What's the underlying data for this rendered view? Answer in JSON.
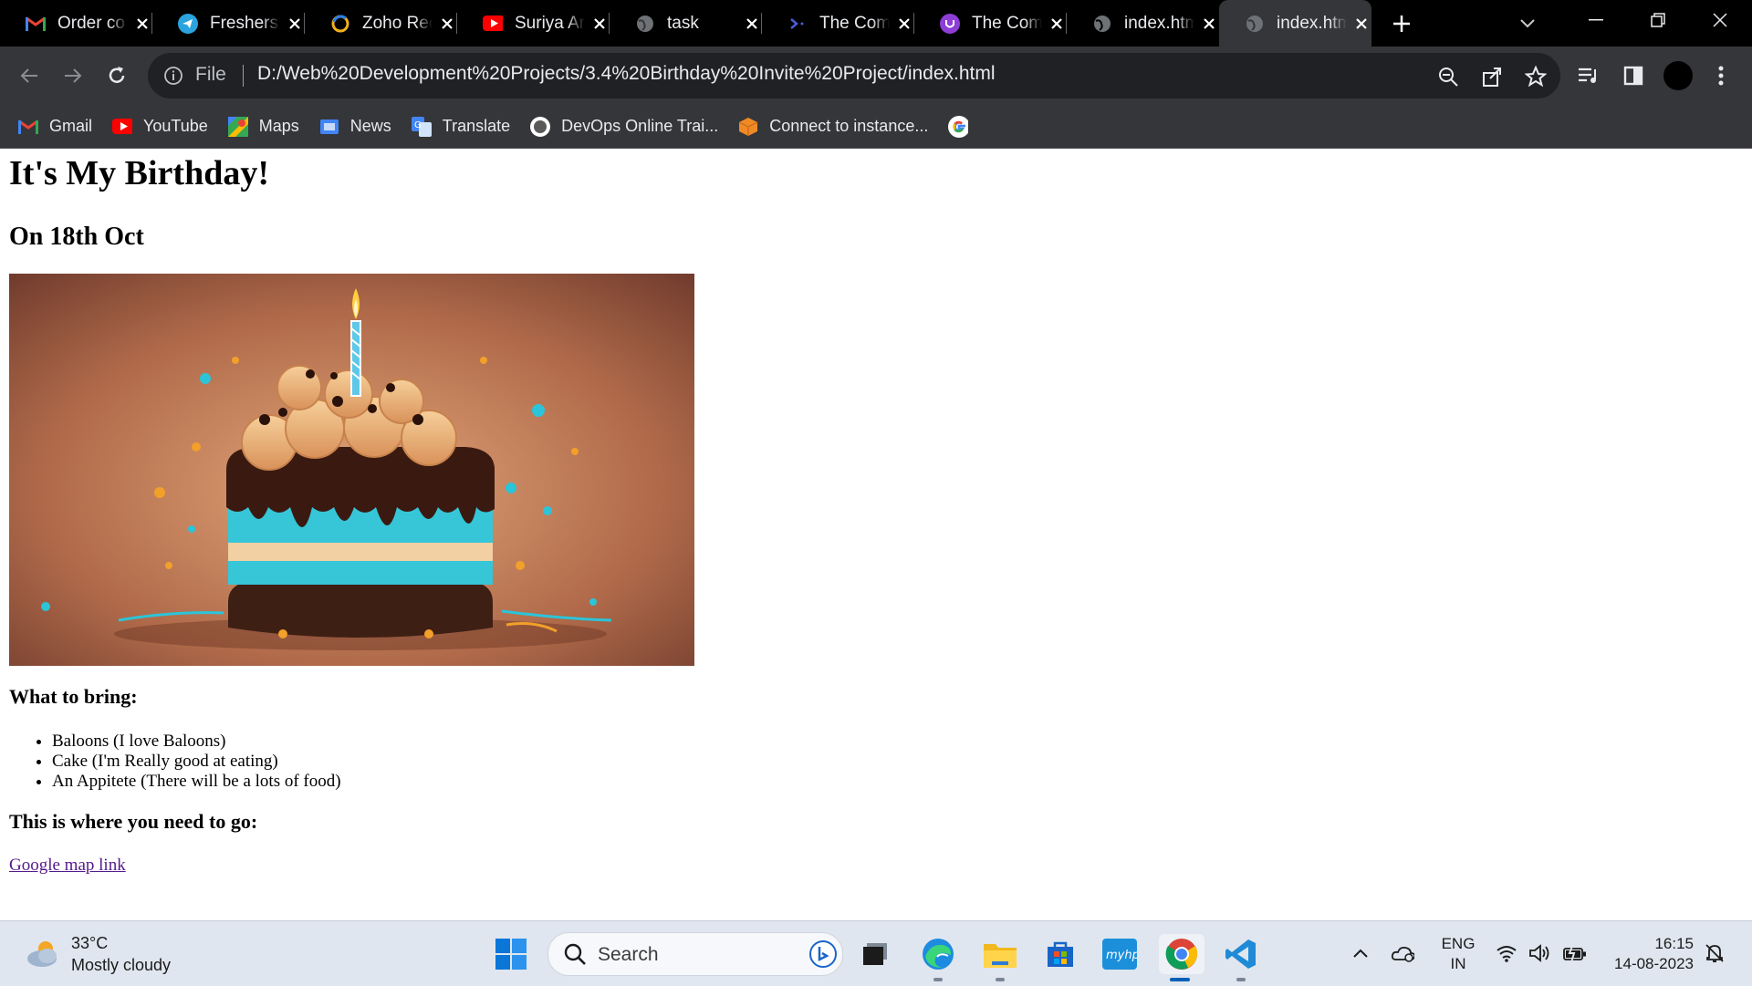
{
  "tabs": [
    {
      "title": "Order co",
      "icon": "gmail-icon"
    },
    {
      "title": "Freshers",
      "icon": "telegram-icon"
    },
    {
      "title": "Zoho Rec",
      "icon": "zoho-icon"
    },
    {
      "title": "Suriya Ar",
      "icon": "youtube-icon"
    },
    {
      "title": "task",
      "icon": "globe-icon"
    },
    {
      "title": "The Com",
      "icon": "code-icon"
    },
    {
      "title": "The Com",
      "icon": "u-badge-icon"
    },
    {
      "title": "index.htm",
      "icon": "globe-icon"
    },
    {
      "title": "index.htm",
      "icon": "globe-icon",
      "active": true
    }
  ],
  "toolbar": {
    "file_label": "File",
    "url": "D:/Web%20Development%20Projects/3.4%20Birthday%20Invite%20Project/index.html"
  },
  "bookmarks": [
    {
      "label": "Gmail",
      "icon": "gmail-icon"
    },
    {
      "label": "YouTube",
      "icon": "youtube-icon"
    },
    {
      "label": "Maps",
      "icon": "maps-icon"
    },
    {
      "label": "News",
      "icon": "news-icon"
    },
    {
      "label": "Translate",
      "icon": "translate-icon"
    },
    {
      "label": "DevOps Online Trai...",
      "icon": "devops-icon"
    },
    {
      "label": "Connect to instance...",
      "icon": "cube-icon"
    },
    {
      "label": "",
      "icon": "google-icon"
    }
  ],
  "page": {
    "heading": "It's My Birthday!",
    "date": "On 18th Oct",
    "bring_heading": "What to bring:",
    "bring_items": [
      "Baloons (I love Baloons)",
      "Cake (I'm Really good at eating)",
      "An Appitete (There will be a lots of food)"
    ],
    "where_heading": "This is where you need to go:",
    "map_link": "Google map link"
  },
  "taskbar": {
    "temperature": "33°C",
    "weather": "Mostly cloudy",
    "search_label": "Search",
    "lang_top": "ENG",
    "lang_bottom": "IN",
    "time": "16:15",
    "date": "14-08-2023"
  },
  "colors": {
    "tab_strip": "#000000",
    "toolbar": "#35363a",
    "omnibox": "#202124",
    "taskbar": "#dfe6ef",
    "visited_link": "#551a8b"
  }
}
